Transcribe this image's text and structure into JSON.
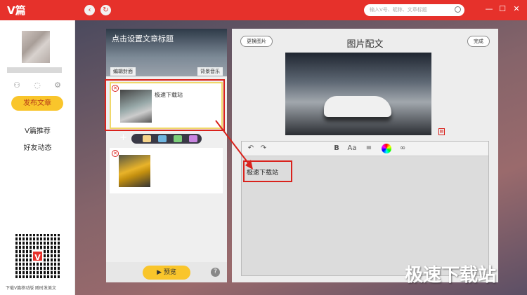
{
  "app": {
    "logo": "V篇"
  },
  "titlebar": {
    "search_placeholder": "输入V号、昵称、文章标题",
    "win_minimize": "—",
    "win_restore": "☐",
    "win_close": "✕",
    "nav_back": "‹",
    "nav_refresh": "↻"
  },
  "sidebar": {
    "publish_label": "发布文章",
    "items": [
      {
        "label": "V篇推荐"
      },
      {
        "label": "好友动态"
      }
    ],
    "qr_logo": "V",
    "qr_caption": "下载V篇移动版 随时发美文"
  },
  "left_panel": {
    "cover_title": "点击设置文章标题",
    "cover_edit_label": "编辑封面",
    "cover_music_label": "背景音乐",
    "cards": [
      {
        "text": "极速下载站",
        "image": "car-showroom-white"
      },
      {
        "text": "",
        "image": "car-yellow"
      }
    ],
    "add_icons": [
      "text-icon",
      "image-icon",
      "music-icon",
      "video-icon"
    ],
    "preview_label": "预览",
    "help_label": "?"
  },
  "editor": {
    "title": "图片配文",
    "replace_image_label": "更换图片",
    "done_label": "完成",
    "toolbar_tools": [
      "undo-icon",
      "redo-icon",
      "bold-icon",
      "font-size-icon",
      "align-icon",
      "color-icon",
      "link-icon"
    ],
    "content_text": "极速下载站"
  },
  "watermark": "极速下载站",
  "colors": {
    "brand_red": "#e6312b",
    "accent_yellow": "#f9c52b",
    "highlight_red": "#d9221c"
  }
}
